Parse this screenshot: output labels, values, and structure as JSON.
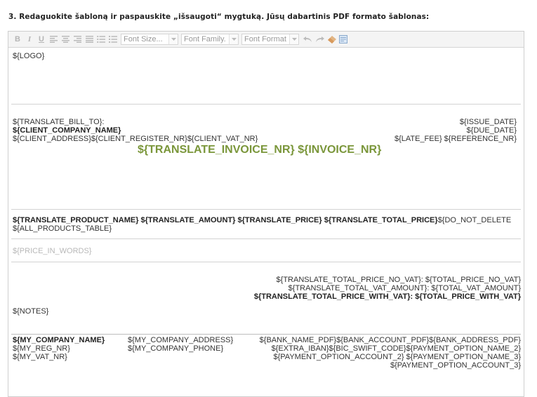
{
  "heading": "3. Redaguokite šabloną ir paspauskite „išsaugoti“ mygtuką. Jūsų dabartinis PDF formato šablonas:",
  "toolbar": {
    "bold": "B",
    "italic": "I",
    "underline": "U",
    "font_size_placeholder": "Font Size...",
    "font_family_placeholder": "Font Family.",
    "font_format_placeholder": "Font Format"
  },
  "template": {
    "logo": "${LOGO}",
    "bill_to": "${TRANSLATE_BILL_TO}:",
    "client_company": "${CLIENT_COMPANY_NAME}",
    "client_address_line": "${CLIENT_ADDRESS}${CLIENT_REGISTER_NR}${CLIENT_VAT_NR}",
    "issue_date": "${ISSUE_DATE}",
    "due_date": "${DUE_DATE}",
    "late_fee_line": "${LATE_FEE} ${REFERENCE_NR}",
    "invoice_title": "${TRANSLATE_INVOICE_NR} ${INVOICE_NR}",
    "products_header": "${TRANSLATE_PRODUCT_NAME} ${TRANSLATE_AMOUNT} ${TRANSLATE_PRICE} ${TRANSLATE_TOTAL_PRICE}",
    "do_not_delete": "${DO_NOT_DELETE",
    "all_products": "${ALL_PRODUCTS_TABLE}",
    "price_in_words": "${PRICE_IN_WORDS}",
    "total_no_vat": "${TRANSLATE_TOTAL_PRICE_NO_VAT}: ${TOTAL_PRICE_NO_VAT}",
    "total_vat": "${TRANSLATE_TOTAL_VAT_AMOUNT}: ${TOTAL_VAT_AMOUNT}",
    "total_with_vat": "${TRANSLATE_TOTAL_PRICE_WITH_VAT}: ${TOTAL_PRICE_WITH_VAT}",
    "notes": "${NOTES}",
    "my_company_name": "${MY_COMPANY_NAME}",
    "my_reg_nr": "${MY_REG_NR}",
    "my_vat_nr": "${MY_VAT_NR}",
    "my_company_address": "${MY_COMPANY_ADDRESS}",
    "my_company_phone": "${MY_COMPANY_PHONE}",
    "bank_line": "${BANK_NAME_PDF}${BANK_ACCOUNT_PDF}${BANK_ADDRESS_PDF}",
    "iban_line": "${EXTRA_IBAN}${BIC_SWIFT_CODE}${PAYMENT_OPTION_NAME_2}",
    "payment_2_line": "${PAYMENT_OPTION_ACCOUNT_2} ${PAYMENT_OPTION_NAME_3}",
    "payment_3_line": "${PAYMENT_OPTION_ACCOUNT_3}"
  },
  "colors": {
    "invoice_title": "#7a963a",
    "toolbar_bg": "#f4f4f4",
    "border": "#cfcfcf"
  }
}
